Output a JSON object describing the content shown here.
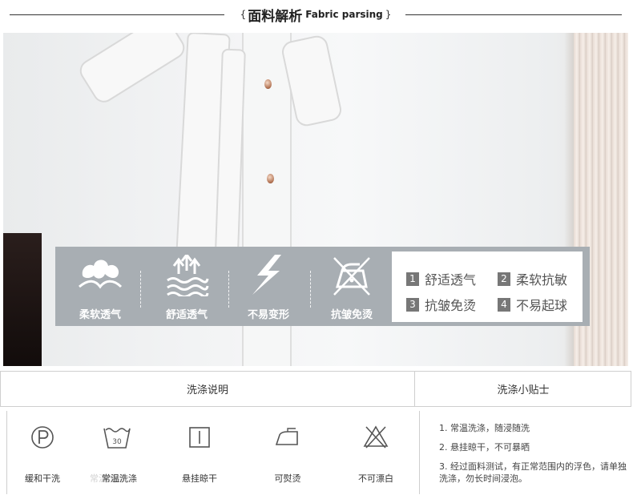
{
  "header": {
    "brace_open": "{",
    "title_zh": "面料解析",
    "title_en": "Fabric parsing",
    "brace_close": "}"
  },
  "features": [
    {
      "icon": "cloud-soft-icon",
      "label": "柔软透气"
    },
    {
      "icon": "breathable-waves-icon",
      "label": "舒适透气"
    },
    {
      "icon": "lightning-shape-icon",
      "label": "不易变形"
    },
    {
      "icon": "iron-crossed-icon",
      "label": "抗皱免烫"
    }
  ],
  "properties": [
    {
      "num": "1",
      "text": "舒适透气"
    },
    {
      "num": "2",
      "text": "柔软抗敏"
    },
    {
      "num": "3",
      "text": "抗皱免烫"
    },
    {
      "num": "4",
      "text": "不易起球"
    }
  ],
  "wash": {
    "instructions_header": "洗涤说明",
    "tips_header": "洗涤小贴士",
    "care": [
      {
        "icon": "dry-clean-p-icon",
        "label": "缓和干洗"
      },
      {
        "icon": "wash-30-icon",
        "label": "常温洗涤",
        "tub_text": "30",
        "faint_text": "常温洗涤"
      },
      {
        "icon": "hang-dry-icon",
        "label": "悬挂晾干"
      },
      {
        "icon": "iron-icon",
        "label": "可熨烫"
      },
      {
        "icon": "no-bleach-icon",
        "label": "不可漂白"
      }
    ],
    "tips": [
      "1. 常温洗涤，随浸随洗",
      "2. 悬挂晾干，不可暴晒",
      "3. 经过面料测试，有正常范围内的浮色，请单独洗涤，勿长时间浸泡。"
    ]
  },
  "colors": {
    "feature_bar": "#a8aeb3",
    "number_badge": "#777777",
    "border": "#cfcfcf"
  }
}
